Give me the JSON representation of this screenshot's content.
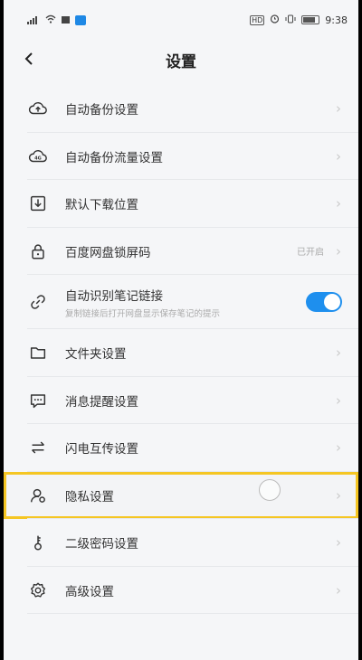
{
  "status_bar": {
    "time": "9:38",
    "hd_badge": "HD"
  },
  "header": {
    "title": "设置",
    "back_icon": "chevron-left-icon"
  },
  "items": [
    {
      "id": "auto-backup",
      "label": "自动备份设置",
      "icon": "cloud-upload-icon"
    },
    {
      "id": "backup-data",
      "label": "自动备份流量设置",
      "icon": "cloud-4g-icon"
    },
    {
      "id": "download-location",
      "label": "默认下载位置",
      "icon": "download-box-icon"
    },
    {
      "id": "lock-code",
      "label": "百度网盘锁屏码",
      "icon": "lock-icon",
      "value": "已开启"
    },
    {
      "id": "note-link",
      "label": "自动识别笔记链接",
      "sub": "复制链接后打开网盘显示保存笔记的提示",
      "icon": "link-icon",
      "toggle_on": true
    },
    {
      "id": "folder",
      "label": "文件夹设置",
      "icon": "folder-icon"
    },
    {
      "id": "notify",
      "label": "消息提醒设置",
      "icon": "message-icon"
    },
    {
      "id": "flash-transfer",
      "label": "闪电互传设置",
      "icon": "transfer-icon"
    },
    {
      "id": "privacy",
      "label": "隐私设置",
      "icon": "privacy-icon"
    },
    {
      "id": "second-password",
      "label": "二级密码设置",
      "icon": "key-icon"
    },
    {
      "id": "advanced",
      "label": "高级设置",
      "icon": "gear-icon"
    }
  ],
  "colors": {
    "accent": "#1e8fee",
    "highlight": "#f5c623"
  }
}
